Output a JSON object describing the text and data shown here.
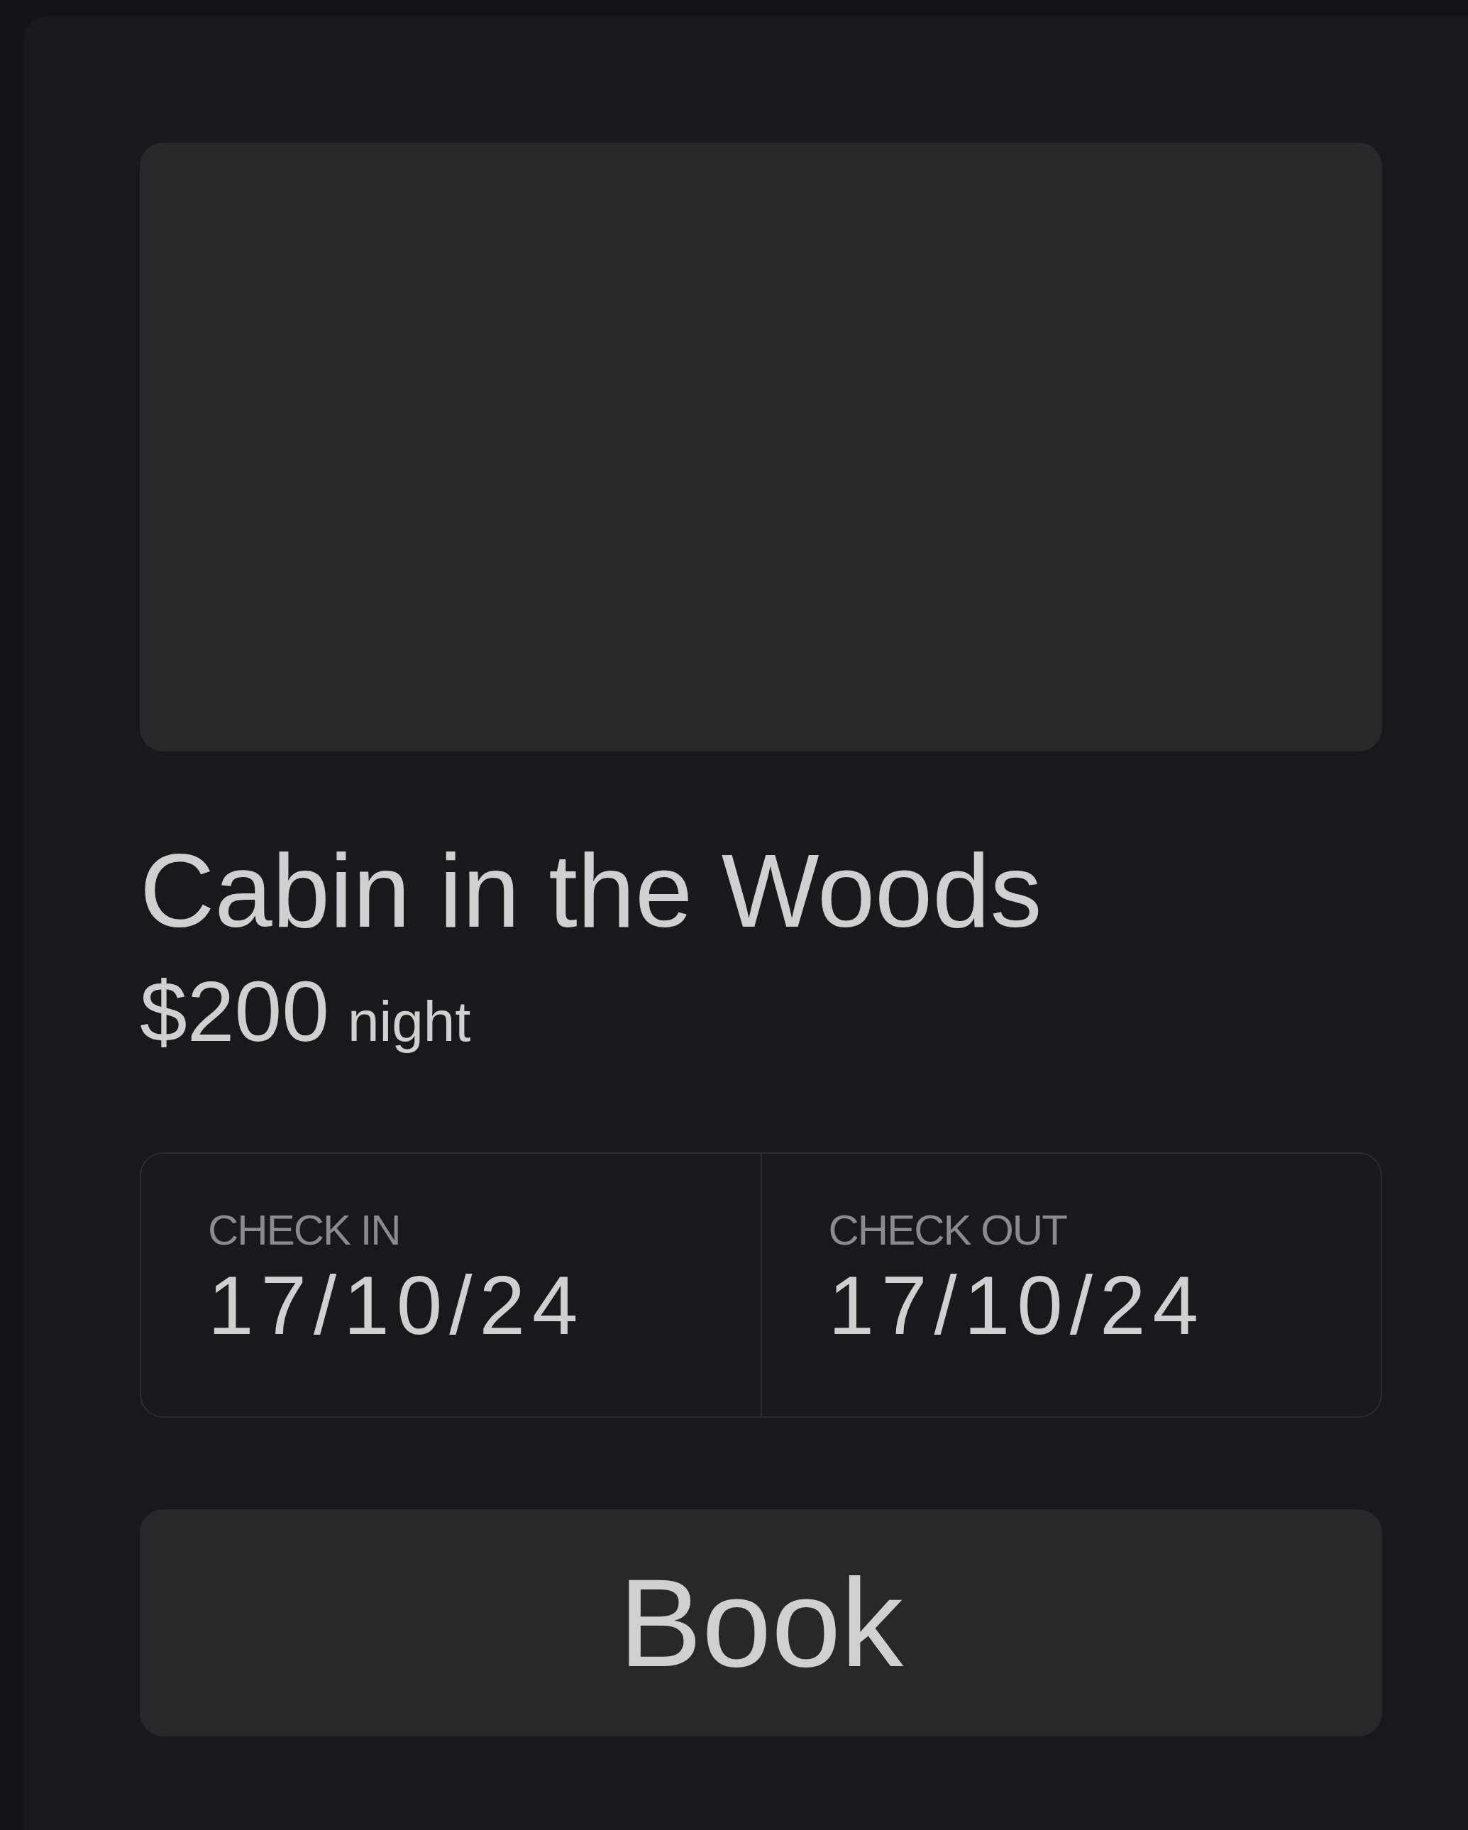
{
  "listing": {
    "title": "Cabin in the Woods",
    "price": "$200",
    "price_unit": "night"
  },
  "dates": [
    {
      "label": "CHECK IN",
      "value": "17/10/24"
    },
    {
      "label": "CHECK OUT",
      "value": "17/10/24"
    }
  ],
  "button": "Book"
}
